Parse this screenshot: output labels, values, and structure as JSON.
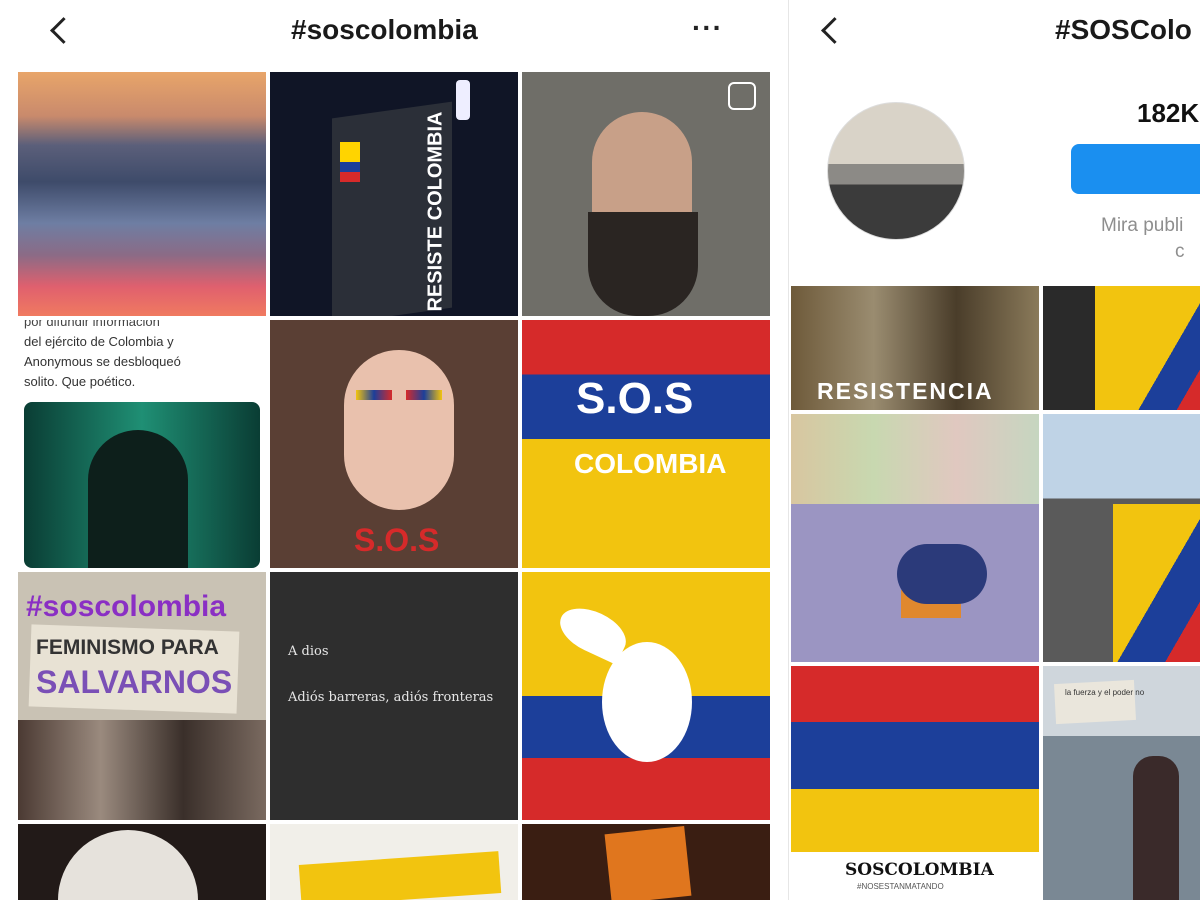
{
  "left": {
    "title": "#soscolombia",
    "more_label": "···",
    "tiles": {
      "t1": {
        "text": "RESISTE COLOMBIA"
      },
      "t4": {
        "line1": "por difundir información",
        "line2": "del ejército de Colombia y",
        "line3": "Anonymous se desbloqueó",
        "line4": "solito. Que poético."
      },
      "t5": {
        "text": "S.O.S"
      },
      "t6": {
        "line1": "S.O.S",
        "line2": "COLOMBIA"
      },
      "t7": {
        "tag": "#soscolombia",
        "sign1": "FEMINISMO PARA",
        "sign2": "SALVARNOS"
      },
      "t8": {
        "line1": "A dios",
        "line2": "Adiós barreras, adiós fronteras"
      }
    }
  },
  "right": {
    "title": "#SOSColo",
    "count": "182K",
    "muted_line1": "Mira publi",
    "muted_line2": "c",
    "tiles": {
      "r1": {
        "text": "RESISTENCIA"
      },
      "r5": {
        "line1": "SOSCOLOMBIA",
        "line2": "#NOSESTANMATANDO"
      },
      "r6": {
        "sign": "la fuerza y el poder no"
      }
    }
  },
  "colors": {
    "accent": "#1a8ff0",
    "flag_yellow": "#f2c40f",
    "flag_blue": "#1c3f9a",
    "flag_red": "#d62a2a"
  }
}
